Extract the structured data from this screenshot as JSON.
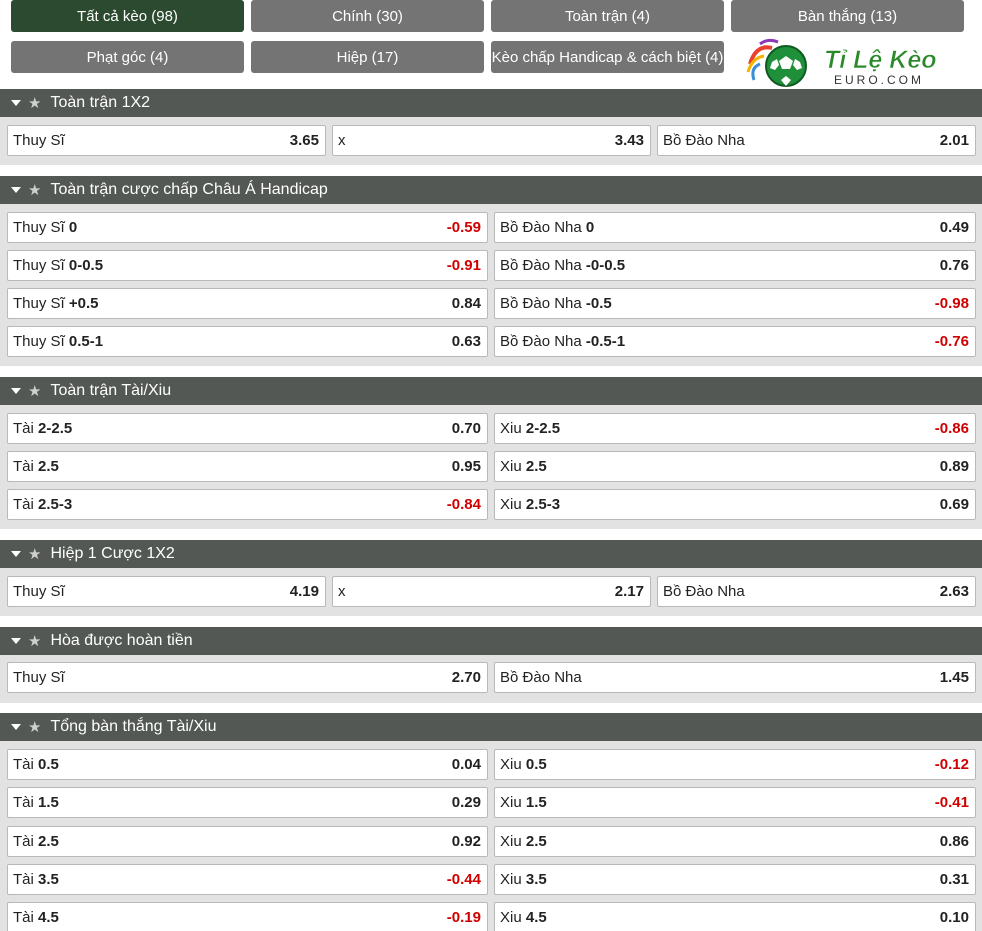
{
  "tabs": [
    {
      "label": "Tất cả kèo (98)",
      "active": true
    },
    {
      "label": "Chính (30)"
    },
    {
      "label": "Toàn trận (4)"
    },
    {
      "label": "Bàn thắng (13)"
    },
    {
      "label": "Phạt góc (4)"
    },
    {
      "label": "Hiệp (17)"
    },
    {
      "label": "Kèo chấp Handicap & cách biệt (4)"
    }
  ],
  "logo": {
    "main": "Tỉ Lệ Kèo",
    "sub": "EURO.COM"
  },
  "sections": [
    {
      "title": "Toàn trận 1X2",
      "rows": [
        [
          {
            "team": "Thuy Sĩ",
            "line": "",
            "odd": "3.65"
          },
          {
            "team": "x",
            "line": "",
            "odd": "3.43"
          },
          {
            "team": "Bồ Đào Nha",
            "line": "",
            "odd": "2.01"
          }
        ]
      ]
    },
    {
      "title": "Toàn trận cược chấp Châu Á Handicap",
      "rows": [
        [
          {
            "team": "Thuy Sĩ",
            "line": "0",
            "odd": "-0.59"
          },
          {
            "team": "Bồ Đào Nha",
            "line": "0",
            "odd": "0.49"
          }
        ],
        [
          {
            "team": "Thuy Sĩ",
            "line": "0-0.5",
            "odd": "-0.91"
          },
          {
            "team": "Bồ Đào Nha",
            "line": "-0-0.5",
            "odd": "0.76"
          }
        ],
        [
          {
            "team": "Thuy Sĩ",
            "line": "+0.5",
            "odd": "0.84"
          },
          {
            "team": "Bồ Đào Nha",
            "line": "-0.5",
            "odd": "-0.98"
          }
        ],
        [
          {
            "team": "Thuy Sĩ",
            "line": "0.5-1",
            "odd": "0.63"
          },
          {
            "team": "Bồ Đào Nha",
            "line": "-0.5-1",
            "odd": "-0.76"
          }
        ]
      ]
    },
    {
      "title": "Toàn trận Tài/Xiu",
      "rows": [
        [
          {
            "team": "Tài",
            "line": "2-2.5",
            "odd": "0.70"
          },
          {
            "team": "Xiu",
            "line": "2-2.5",
            "odd": "-0.86"
          }
        ],
        [
          {
            "team": "Tài",
            "line": "2.5",
            "odd": "0.95"
          },
          {
            "team": "Xiu",
            "line": "2.5",
            "odd": "0.89"
          }
        ],
        [
          {
            "team": "Tài",
            "line": "2.5-3",
            "odd": "-0.84"
          },
          {
            "team": "Xiu",
            "line": "2.5-3",
            "odd": "0.69"
          }
        ]
      ]
    },
    {
      "title": "Hiệp 1 Cược 1X2",
      "rows": [
        [
          {
            "team": "Thuy Sĩ",
            "line": "",
            "odd": "4.19"
          },
          {
            "team": "x",
            "line": "",
            "odd": "2.17"
          },
          {
            "team": "Bồ Đào Nha",
            "line": "",
            "odd": "2.63"
          }
        ]
      ]
    },
    {
      "title": "Hòa được hoàn tiền",
      "rows": [
        [
          {
            "team": "Thuy Sĩ",
            "line": "",
            "odd": "2.70"
          },
          {
            "team": "Bồ Đào Nha",
            "line": "",
            "odd": "1.45"
          }
        ]
      ]
    },
    {
      "title": "Tổng bàn thắng Tài/Xiu",
      "rows": [
        [
          {
            "team": "Tài",
            "line": "0.5",
            "odd": "0.04"
          },
          {
            "team": "Xiu",
            "line": "0.5",
            "odd": "-0.12"
          }
        ],
        [
          {
            "team": "Tài",
            "line": "1.5",
            "odd": "0.29"
          },
          {
            "team": "Xiu",
            "line": "1.5",
            "odd": "-0.41"
          }
        ],
        [
          {
            "team": "Tài",
            "line": "2.5",
            "odd": "0.92"
          },
          {
            "team": "Xiu",
            "line": "2.5",
            "odd": "0.86"
          }
        ],
        [
          {
            "team": "Tài",
            "line": "3.5",
            "odd": "-0.44"
          },
          {
            "team": "Xiu",
            "line": "3.5",
            "odd": "0.31"
          }
        ],
        [
          {
            "team": "Tài",
            "line": "4.5",
            "odd": "-0.19"
          },
          {
            "team": "Xiu",
            "line": "4.5",
            "odd": "0.10"
          }
        ]
      ]
    }
  ]
}
